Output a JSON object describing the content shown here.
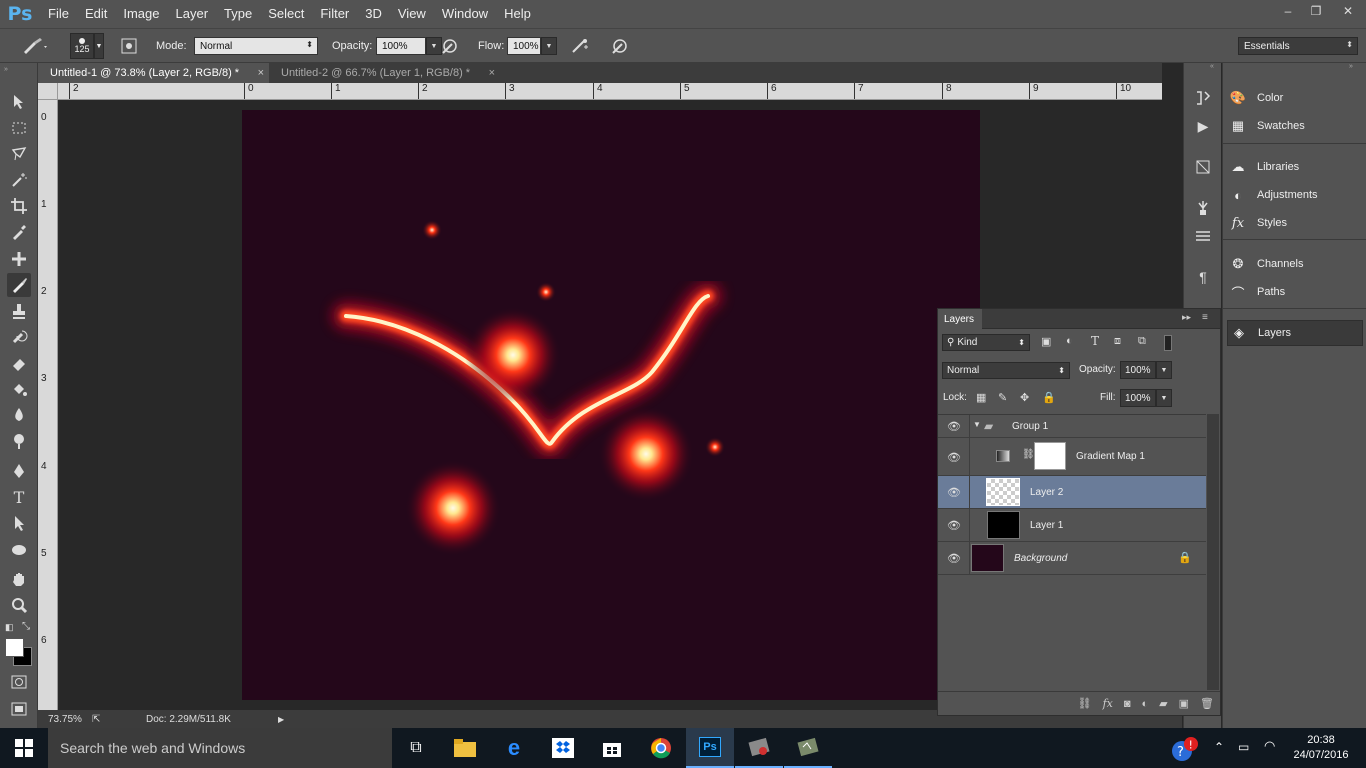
{
  "app": {
    "logo": "Ps"
  },
  "menu": [
    "File",
    "Edit",
    "Image",
    "Layer",
    "Type",
    "Select",
    "Filter",
    "3D",
    "View",
    "Window",
    "Help"
  ],
  "window_controls": {
    "minimize": "–",
    "restore": "❐",
    "close": "✕"
  },
  "options": {
    "brush_size": "125",
    "mode_label": "Mode:",
    "mode_value": "Normal",
    "opacity_label": "Opacity:",
    "opacity_value": "100%",
    "flow_label": "Flow:",
    "flow_value": "100%",
    "workspace": "Essentials"
  },
  "tabs": [
    {
      "label": "Untitled-1 @ 73.8% (Layer 2, RGB/8) *",
      "close": "×"
    },
    {
      "label": "Untitled-2 @ 66.7% (Layer 1, RGB/8) *",
      "close": "×"
    }
  ],
  "ruler_h": [
    "2",
    "0",
    "1",
    "2",
    "3",
    "4",
    "5",
    "6",
    "7",
    "8",
    "9",
    "10"
  ],
  "ruler_v": [
    "0",
    "1",
    "2",
    "3",
    "4",
    "5",
    "6"
  ],
  "status": {
    "zoom": "73.75%",
    "doc": "Doc: 2.29M/511.8K"
  },
  "panels": {
    "group1": [
      "Color",
      "Swatches"
    ],
    "group2": [
      "Libraries",
      "Adjustments",
      "Styles"
    ],
    "group3": [
      "Channels",
      "Paths"
    ],
    "group4": [
      "Layers"
    ]
  },
  "layers_panel": {
    "title": "Layers",
    "filter_kind": "Kind",
    "blend_mode": "Normal",
    "opacity_label": "Opacity:",
    "opacity_value": "100%",
    "lock_label": "Lock:",
    "fill_label": "Fill:",
    "fill_value": "100%",
    "layers": [
      {
        "name": "Group 1",
        "type": "group"
      },
      {
        "name": "Gradient Map 1",
        "type": "adjustment"
      },
      {
        "name": "Layer 2",
        "type": "pixel",
        "selected": true
      },
      {
        "name": "Layer 1",
        "type": "pixel"
      },
      {
        "name": "Background",
        "type": "background",
        "locked": true
      }
    ]
  },
  "taskbar": {
    "search_placeholder": "Search the web and Windows",
    "time": "20:38",
    "date": "24/07/2016"
  },
  "colors": {
    "canvas_bg": "#24071a",
    "glow_core": "#fff3c0",
    "glow_mid": "#ff2a10",
    "selected_layer": "#6a7c99",
    "ps_blue": "#5ab4f0"
  }
}
